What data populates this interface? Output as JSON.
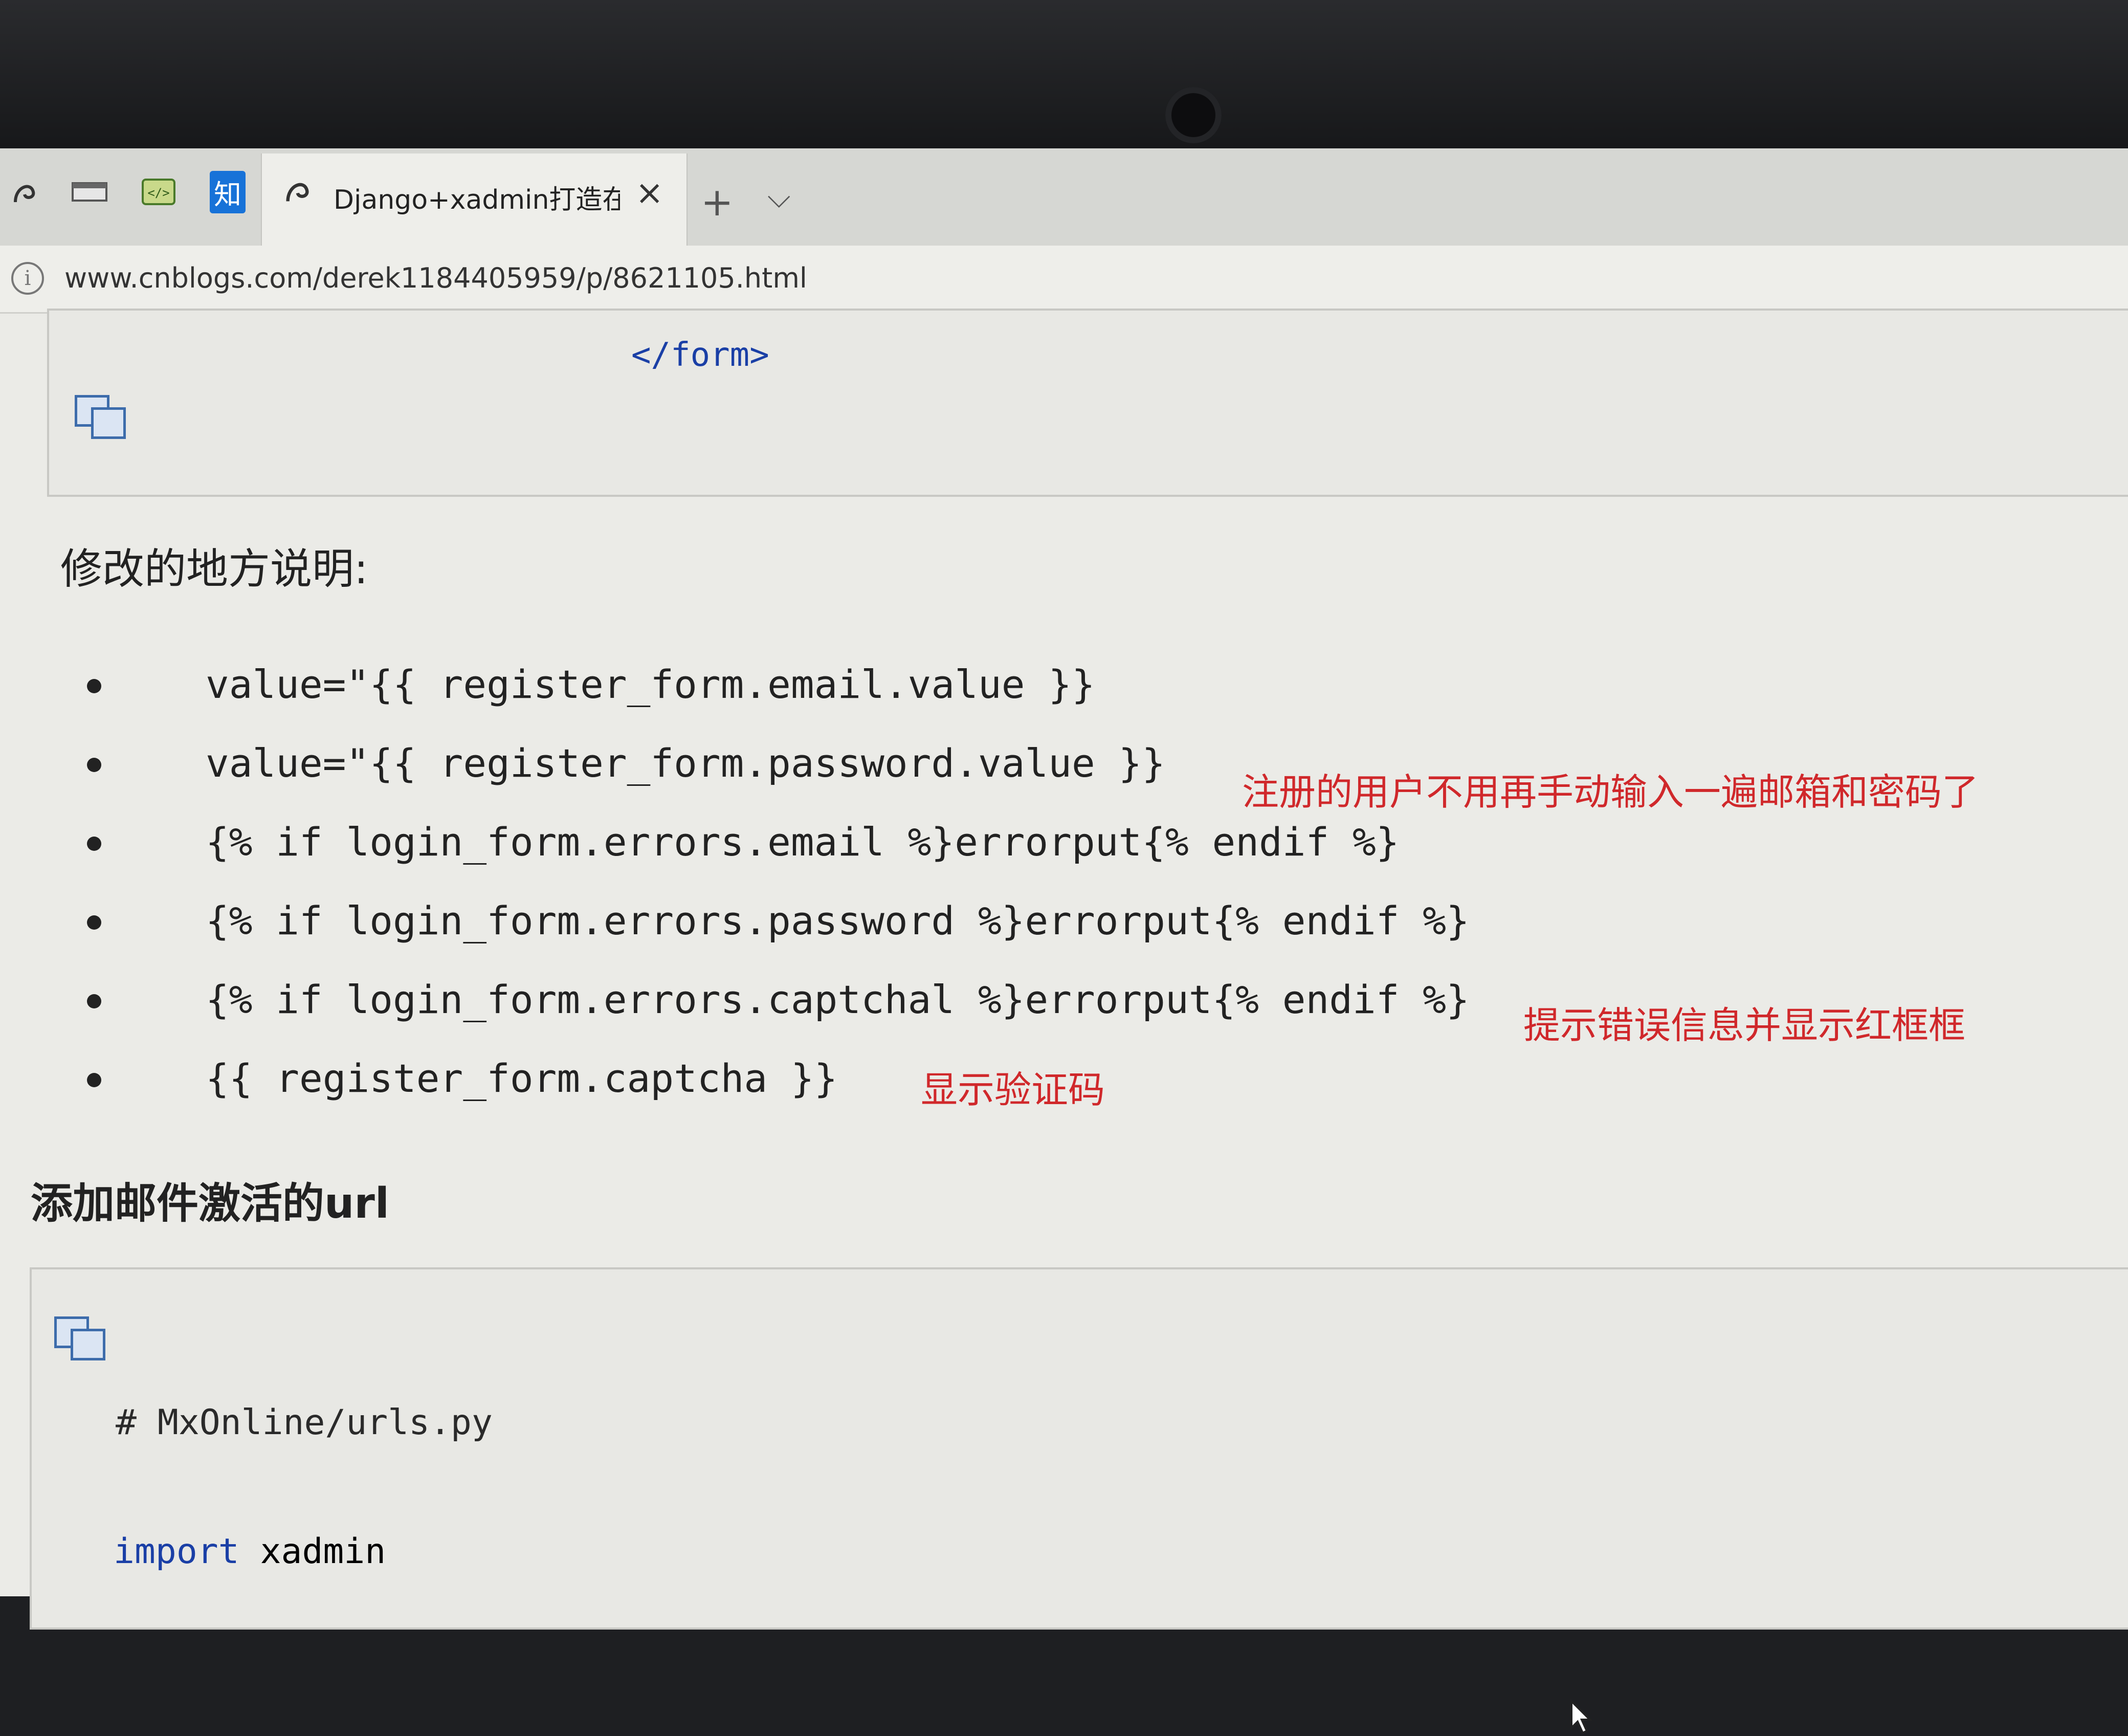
{
  "browser": {
    "pinned_tabs": [
      {
        "icon": "cnblogs-icon"
      },
      {
        "icon": "window-icon"
      },
      {
        "icon": "code-icon"
      },
      {
        "icon": "zhihu-icon",
        "label": "知"
      }
    ],
    "active_tab": {
      "title": "Django+xadmin打造在",
      "icon": "cnblogs-icon",
      "close_label": "×"
    },
    "new_tab_label": "+",
    "tab_list_label": "⌵",
    "address": "www.cnblogs.com/derek1184405959/p/8621105.html"
  },
  "article": {
    "top_code": {
      "closing_tag": "</form>"
    },
    "explanation_heading": "修改的地方说明:",
    "bullets": [
      {
        "code": "value=\"{{ register_form.email.value }}"
      },
      {
        "code": "value=\"{{ register_form.password.value }}",
        "note": "注册的用户不用再手动输入一遍邮箱和密码了"
      },
      {
        "code": "{% if login_form.errors.email %}errorput{% endif %}"
      },
      {
        "code": "{% if login_form.errors.password %}errorput{% endif %}"
      },
      {
        "code": "{% if login_form.errors.captchal %}errorput{% endif %}",
        "note": "提示错误信息并显示红框框"
      },
      {
        "code": "{{ register_form.captcha }}",
        "note": "显示验证码"
      }
    ],
    "section_heading": "添加邮件激活的url",
    "bottom_code": {
      "comment": "# MxOnline/urls.py",
      "import_keyword": "import",
      "import_module": "xadmin"
    }
  },
  "colors": {
    "note": "#d0282b",
    "keyword": "#1a3fa6",
    "page_background": "#ebebe7"
  }
}
